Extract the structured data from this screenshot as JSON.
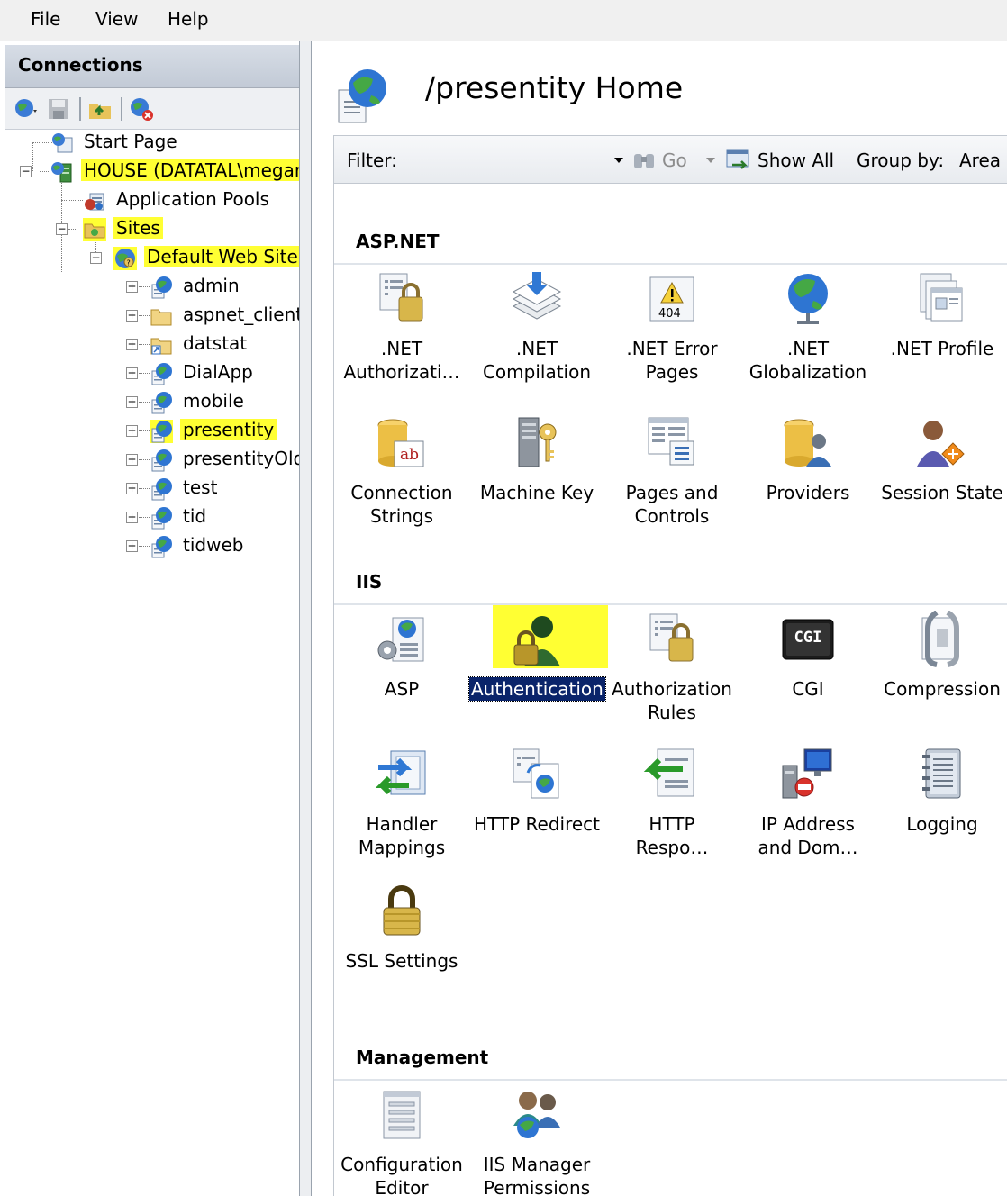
{
  "menu": {
    "file": "File",
    "view": "View",
    "help": "Help"
  },
  "connections": {
    "title": "Connections",
    "tree": [
      {
        "label": "Start Page"
      },
      {
        "label": "HOUSE (DATATAL\\megar"
      },
      {
        "label": "Application Pools"
      },
      {
        "label": "Sites"
      },
      {
        "label": "Default Web Site"
      },
      {
        "label": "admin"
      },
      {
        "label": "aspnet_client"
      },
      {
        "label": "datstat"
      },
      {
        "label": "DialApp"
      },
      {
        "label": "mobile"
      },
      {
        "label": "presentity"
      },
      {
        "label": "presentityOld"
      },
      {
        "label": "test"
      },
      {
        "label": "tid"
      },
      {
        "label": "tidweb"
      }
    ]
  },
  "page": {
    "title": "/presentity Home",
    "filter_label": "Filter:",
    "filter_value": "",
    "go_label": "Go",
    "show_all_label": "Show All",
    "group_by_label": "Group by:",
    "group_by_value": "Area"
  },
  "sections": [
    {
      "title": "ASP.NET",
      "features": [
        {
          "label": ".NET\nAuthorizati…",
          "icon": "lock-document-icon"
        },
        {
          "label": ".NET\nCompilation",
          "icon": "stack-download-icon"
        },
        {
          "label": ".NET Error\nPages",
          "icon": "warning-404-icon"
        },
        {
          "label": ".NET\nGlobalization",
          "icon": "globe-icon"
        },
        {
          "label": ".NET Profile",
          "icon": "profile-window-icon"
        },
        {
          "label": "Connection\nStrings",
          "icon": "database-ab-icon"
        },
        {
          "label": "Machine Key",
          "icon": "server-key-icon"
        },
        {
          "label": "Pages and\nControls",
          "icon": "pages-controls-icon"
        },
        {
          "label": "Providers",
          "icon": "database-user-icon"
        },
        {
          "label": "Session State",
          "icon": "user-diamond-icon"
        }
      ]
    },
    {
      "title": "IIS",
      "features": [
        {
          "label": "ASP",
          "icon": "globe-gear-document-icon"
        },
        {
          "label": "Authentication",
          "icon": "user-lock-icon"
        },
        {
          "label": "Authorization\nRules",
          "icon": "lock-document-icon"
        },
        {
          "label": "CGI",
          "icon": "cgi-icon",
          "text": "CGI"
        },
        {
          "label": "Compression",
          "icon": "clamp-document-icon"
        },
        {
          "label": "Handler\nMappings",
          "icon": "arrows-box-icon"
        },
        {
          "label": "HTTP Redirect",
          "icon": "documents-globe-icon"
        },
        {
          "label": "HTTP\nRespo…",
          "icon": "arrow-document-icon"
        },
        {
          "label": "IP Address\nand Dom…",
          "icon": "computer-block-icon"
        },
        {
          "label": "Logging",
          "icon": "notebook-icon"
        },
        {
          "label": "SSL Settings",
          "icon": "padlock-icon"
        }
      ]
    },
    {
      "title": "Management",
      "features": [
        {
          "label": "Configuration\nEditor",
          "icon": "config-form-icon"
        },
        {
          "label": "IIS Manager\nPermissions",
          "icon": "users-globe-icon"
        }
      ]
    }
  ],
  "colors": {
    "highlight": "#ffff33",
    "selection": "#0a246a",
    "header": "#c9d0da"
  }
}
